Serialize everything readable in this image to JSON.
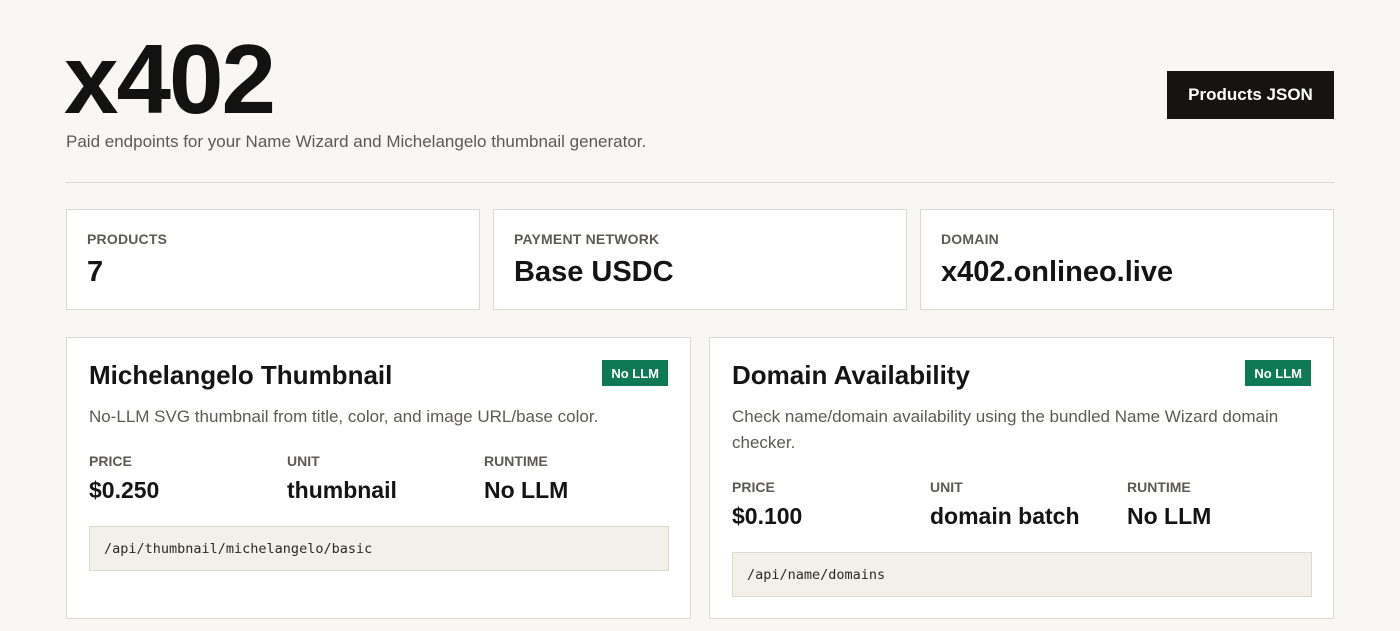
{
  "header": {
    "title": "x402",
    "subtitle": "Paid endpoints for your Name Wizard and Michelangelo thumbnail generator.",
    "products_json_label": "Products JSON"
  },
  "stats": [
    {
      "label": "PRODUCTS",
      "value": "7"
    },
    {
      "label": "PAYMENT NETWORK",
      "value": "Base USDC"
    },
    {
      "label": "DOMAIN",
      "value": "x402.onlineo.live"
    }
  ],
  "products": [
    {
      "title": "Michelangelo Thumbnail",
      "badge": "No LLM",
      "description": "No-LLM SVG thumbnail from title, color, and image URL/base color.",
      "price_label": "PRICE",
      "price": "$0.250",
      "unit_label": "UNIT",
      "unit": "thumbnail",
      "runtime_label": "RUNTIME",
      "runtime": "No LLM",
      "endpoint": "/api/thumbnail/michelangelo/basic"
    },
    {
      "title": "Domain Availability",
      "badge": "No LLM",
      "description": "Check name/domain availability using the bundled Name Wizard domain checker.",
      "price_label": "PRICE",
      "price": "$0.100",
      "unit_label": "UNIT",
      "unit": "domain batch",
      "runtime_label": "RUNTIME",
      "runtime": "No LLM",
      "endpoint": "/api/name/domains"
    }
  ],
  "colors": {
    "background": "#f8f7f3",
    "accent_button": "#151412",
    "badge_green": "#0e7a55"
  }
}
